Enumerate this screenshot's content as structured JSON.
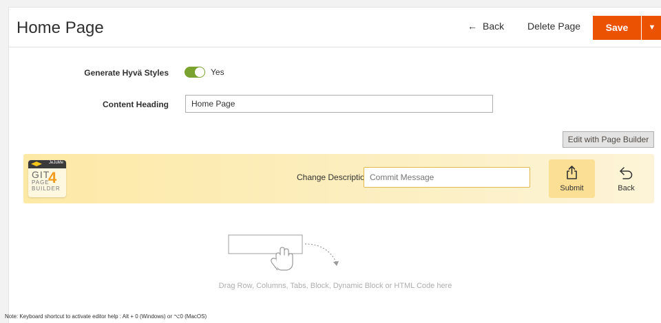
{
  "header": {
    "title": "Home Page",
    "back_label": "Back",
    "back_arrow": "←",
    "delete_label": "Delete Page",
    "save_label": "Save",
    "save_dropdown_icon": "▼"
  },
  "form": {
    "hyva_label": "Generate Hyvä Styles",
    "hyva_value": "Yes",
    "hyva_enabled": true,
    "heading_label": "Content Heading",
    "heading_value": "Home Page"
  },
  "page_builder": {
    "edit_button": "Edit with Page Builder",
    "drop_hint": "Drag Row, Columns, Tabs, Block, Dynamic Block or HTML Code here"
  },
  "git_bar": {
    "logo_brand": "JeJuMe",
    "logo_word1": "GIT",
    "logo_word2": "PAGE",
    "logo_word3": "BUILDER",
    "logo_number": "4",
    "change_label": "Change Description",
    "commit_placeholder": "Commit Message",
    "submit_label": "Submit",
    "back_label": "Back"
  },
  "note": "Note: Keyboard shortcut to activate editor help : Alt + 0 (Windows) or ⌥0 (MacOS)",
  "colors": {
    "accent": "#eb5202",
    "toggle_on": "#79a22e",
    "git_bar": "#fdecb0"
  },
  "icons": {
    "submit": "upload-icon",
    "back": "undo-arrow-icon",
    "drop": "hand-drag-icon"
  }
}
